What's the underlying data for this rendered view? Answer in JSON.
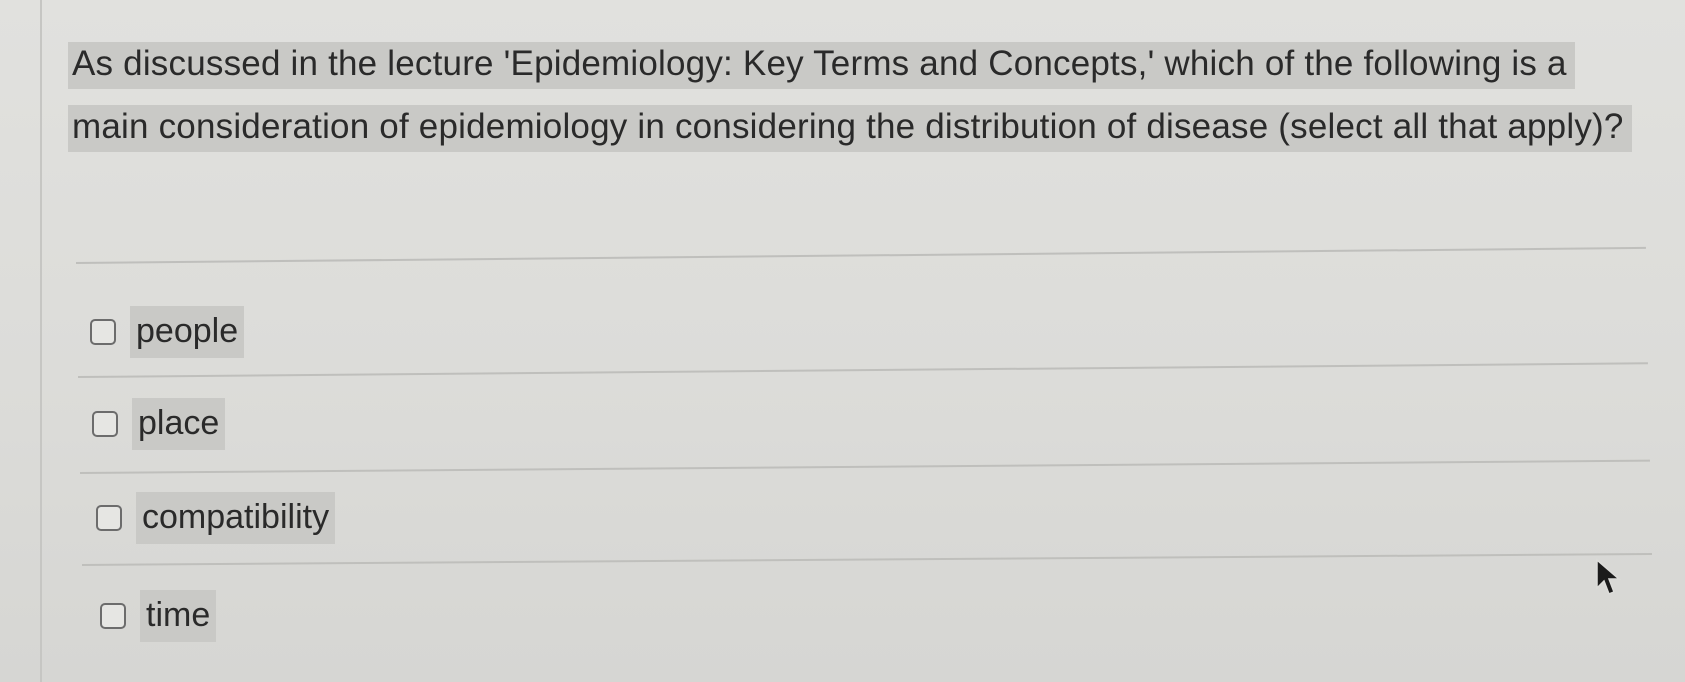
{
  "question": {
    "text": "As discussed in the lecture 'Epidemiology: Key Terms and Concepts,' which of the following is a main consideration of epidemiology in considering the distribution of disease (select all that apply)?"
  },
  "options": [
    {
      "label": "people",
      "checked": false
    },
    {
      "label": "place",
      "checked": false
    },
    {
      "label": "compatibility",
      "checked": false
    },
    {
      "label": "time",
      "checked": false
    }
  ],
  "icons": {
    "checkbox": "checkbox-empty-icon",
    "cursor": "mouse-pointer-icon"
  },
  "colors": {
    "background": "#dcdcd9",
    "text": "#2a2a2a",
    "highlight": "#c9c9c6"
  }
}
